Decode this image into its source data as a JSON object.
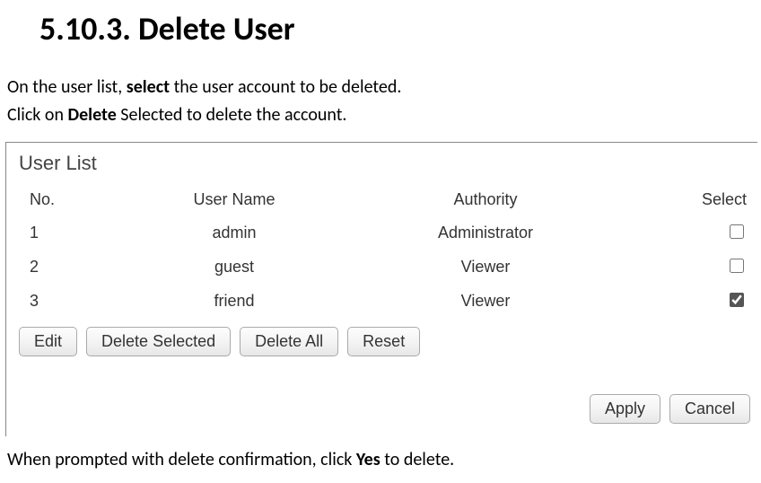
{
  "heading": {
    "number": "5.10.3.",
    "title": "Delete User"
  },
  "intro": {
    "line1_pre": "On the user list, ",
    "line1_bold": "select",
    "line1_post": " the user account to be deleted.",
    "line2_pre": "Click on ",
    "line2_bold": "Delete",
    "line2_post": " Selected to delete the account."
  },
  "screenshot": {
    "title": "User List",
    "headers": {
      "no": "No.",
      "user": "User Name",
      "auth": "Authority",
      "select": "Select"
    },
    "rows": [
      {
        "no": "1",
        "user": "admin",
        "auth": "Administrator",
        "checked": false
      },
      {
        "no": "2",
        "user": "guest",
        "auth": "Viewer",
        "checked": false
      },
      {
        "no": "3",
        "user": "friend",
        "auth": "Viewer",
        "checked": true
      }
    ],
    "buttons": {
      "edit": "Edit",
      "delete_selected": "Delete Selected",
      "delete_all": "Delete All",
      "reset": "Reset",
      "apply": "Apply",
      "cancel": "Cancel"
    }
  },
  "outro": {
    "pre": "When prompted with delete confirmation, click ",
    "bold": "Yes",
    "post": " to delete."
  }
}
